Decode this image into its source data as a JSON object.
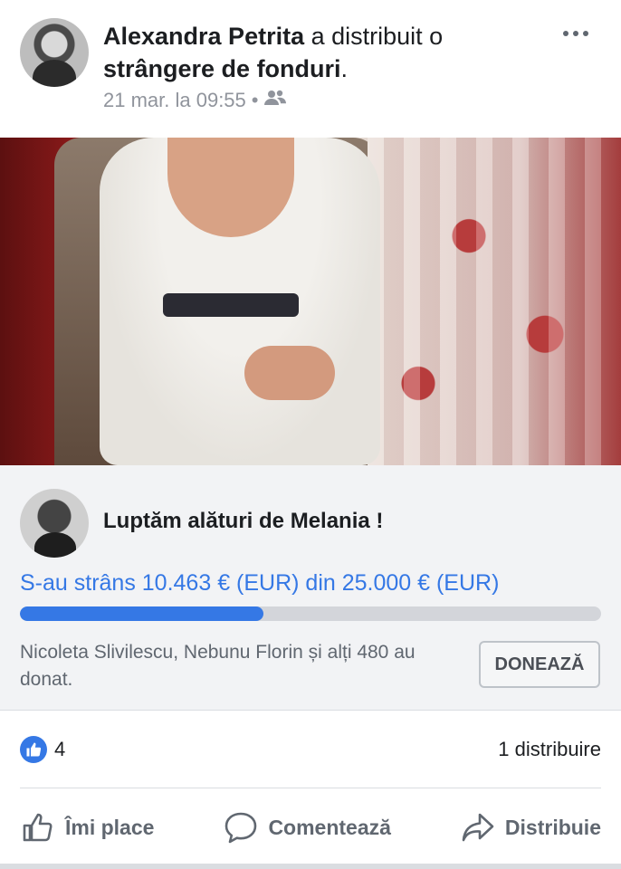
{
  "post": {
    "author": "Alexandra Petrita",
    "action_text": "a distribuit o",
    "object_text": "strângere de fonduri",
    "punctuation": ".",
    "timestamp": "21 mar. la 09:55",
    "separator": "•",
    "audience_icon": "friends-icon"
  },
  "fundraiser": {
    "title": "Luptăm alături de Melania !",
    "raised_text": "S-au strâns 10.463 € (EUR) din 25.000 € (EUR)",
    "raised": 10463,
    "goal": 25000,
    "progress_fraction": 0.4185,
    "donors_text": "Nicoleta Slivilescu, Nebunu Florin și alți 480 au donat.",
    "donate_label": "DONEAZĂ"
  },
  "reactions": {
    "likes": "4",
    "shares": "1 distribuire"
  },
  "actions": {
    "like": "Îmi place",
    "comment": "Comentează",
    "share": "Distribuie"
  },
  "colors": {
    "accent": "#3578e5",
    "muted": "#606770",
    "fund_bg": "#f2f3f5"
  }
}
